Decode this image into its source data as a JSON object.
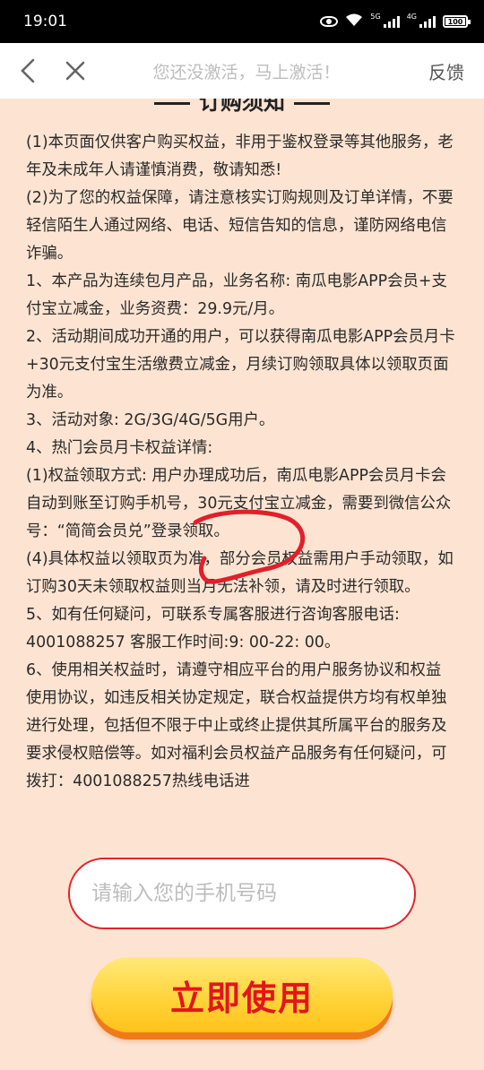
{
  "status_bar": {
    "time": "19:01",
    "signal1_label": "5G",
    "signal2_label": "4G",
    "battery_level": "100"
  },
  "nav": {
    "title": "您还没激活，马上激活！",
    "feedback": "反馈"
  },
  "terms": {
    "heading": "订购须知",
    "paragraphs": [
      "(1)本页面仅供客户购买权益，非用于鉴权登录等其他服务，老年及未成年人请谨慎消费，敬请知悉!",
      "(2)为了您的权益保障，请注意核实订购规则及订单详情，不要轻信陌生人通过网络、电话、短信告知的信息，谨防网络电信诈骗。",
      "1、本产品为连续包月产品，业务名称: 南瓜电影APP会员+支付宝立减金，业务资费：29.9元/月。",
      "2、活动期间成功开通的用户，可以获得南瓜电影APP会员月卡+30元支付宝生活缴费立减金，月续订购领取具体以领取页面为准。",
      "3、活动对象: 2G/3G/4G/5G用户。",
      "4、热门会员月卡权益详情:",
      "(1)权益领取方式: 用户办理成功后，南瓜电影APP会员月卡会自动到账至订购手机号，30元支付宝立减金，需要到微信公众号：“简简会员兑”登录领取。",
      "(4)具体权益以领取页为准，部分会员权益需用户手动领取，如订购30天未领取权益则当月无法补领，请及时进行领取。",
      "5、如有任何疑问，可联系专属客服进行咨询客服电话: 4001088257 客服工作时间:9: 00-22: 00。",
      "6、使用相关权益时，请遵守相应平台的用户服务协议和权益使用协议，如违反相关协定规定，联合权益提供方均有权单独进行处理，包括但不限于中止或终止提供其所属平台的服务及要求侵权赔偿等。如对福利会员权益产品服务有任何疑问，可拨打：4001088257热线电话进"
    ]
  },
  "form": {
    "phone_placeholder": "请输入您的手机号码",
    "phone_value": "",
    "submit_label": "立即使用"
  },
  "colors": {
    "page_bg": "#fde4d2",
    "input_border": "#e2232a",
    "button_yellow": "#ffd43b",
    "button_text": "#e3151b",
    "annotation_red": "#e0202a"
  }
}
